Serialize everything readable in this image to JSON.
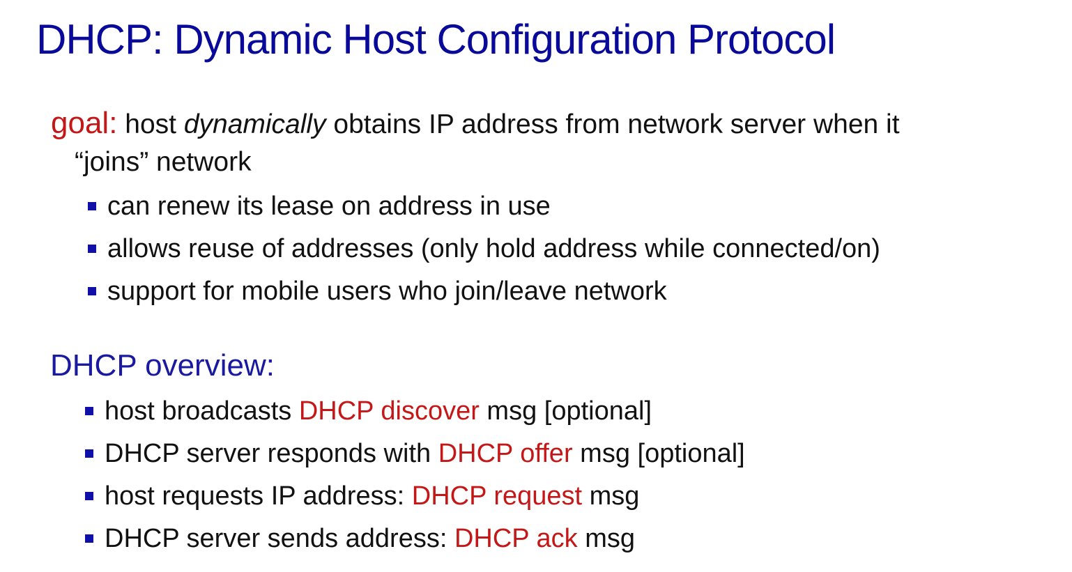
{
  "title": "DHCP: Dynamic Host Configuration Protocol",
  "goal": {
    "label": "goal:",
    "text_before": " host ",
    "emphasis": "dynamically",
    "text_after": " obtains IP address from network server when it",
    "line2": "“joins” network"
  },
  "goal_bullets": [
    "can renew its lease on address in use",
    "allows reuse of addresses (only hold address while connected/on)",
    "support for mobile users who join/leave network"
  ],
  "overview": {
    "heading": "DHCP overview:",
    "items": [
      {
        "before": "host broadcasts ",
        "highlight": "DHCP discover",
        "after": " msg [optional]"
      },
      {
        "before": "DHCP server responds with ",
        "highlight": "DHCP offer",
        "after": " msg [optional]"
      },
      {
        "before": "host requests IP address: ",
        "highlight": "DHCP request",
        "after": " msg"
      },
      {
        "before": "DHCP server sends address: ",
        "highlight": "DHCP ack",
        "after": " msg"
      }
    ]
  },
  "colors": {
    "title": "#0a0a9a",
    "keyword_red": "#c41818",
    "bullet_square": "#1010a8",
    "body_text": "#111111"
  }
}
